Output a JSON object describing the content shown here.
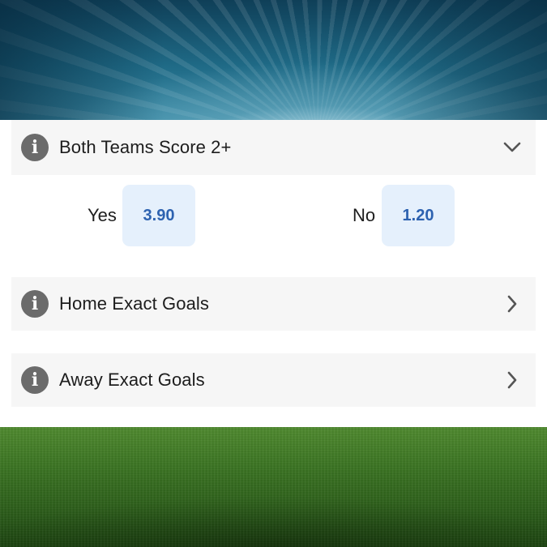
{
  "markets": [
    {
      "title": "Both Teams Score 2+",
      "expanded": true,
      "chevron_icon": "chevron-down-icon",
      "selections": [
        {
          "label": "Yes",
          "odds": "3.90"
        },
        {
          "label": "No",
          "odds": "1.20"
        }
      ]
    },
    {
      "title": "Home Exact Goals",
      "expanded": false,
      "chevron_icon": "chevron-right-icon"
    },
    {
      "title": "Away Exact Goals",
      "expanded": false,
      "chevron_icon": "chevron-right-icon"
    }
  ],
  "info_icon_glyph": "i",
  "colors": {
    "odds_text": "#2d62b0",
    "odds_bg": "#e5f0fc",
    "market_header_bg": "#f6f6f6",
    "info_icon_bg": "#6b6b6b"
  }
}
